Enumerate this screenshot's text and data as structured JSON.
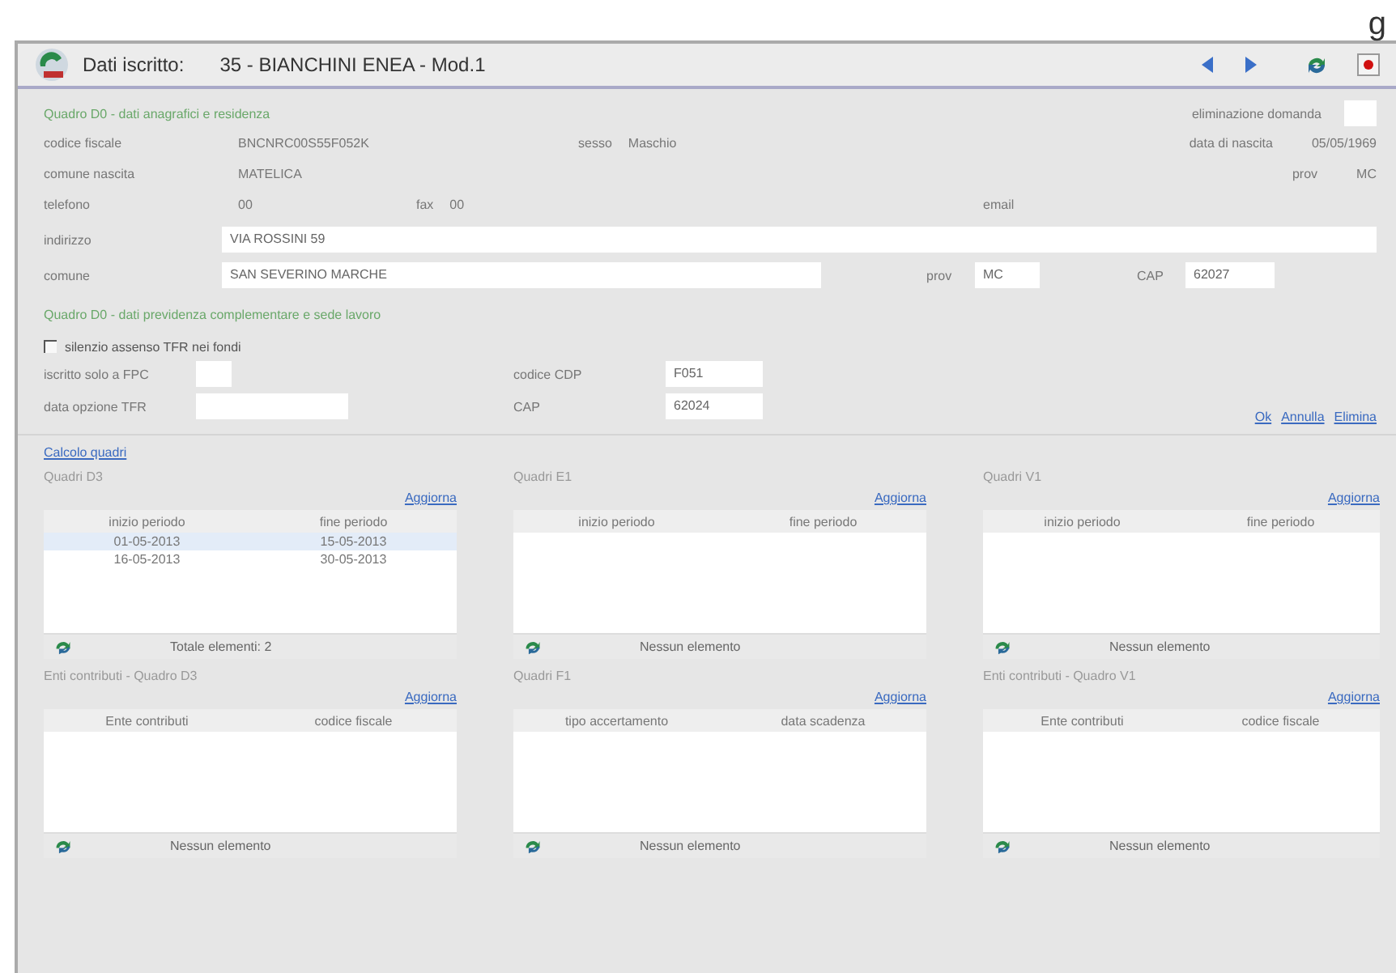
{
  "corner_text": "g",
  "window": {
    "label": "Dati iscritto:",
    "title": "35 - BIANCHINI ENEA - Mod.1"
  },
  "personal": {
    "heading": "Quadro D0 - dati anagrafici e residenza",
    "deletion": {
      "label": "eliminazione domanda",
      "checked": false
    },
    "rows": [
      [
        {
          "label": "codice fiscale",
          "value": "BNCNRC00S55F052K"
        },
        {
          "label": "sesso",
          "value": "Maschio"
        },
        {
          "label": "data di nascita",
          "value": "05/05/1969"
        }
      ],
      [
        {
          "label": "comune nascita",
          "value": "MATELICA"
        },
        {
          "label": "prov",
          "value": "MC"
        }
      ],
      [
        {
          "label": "telefono",
          "value": "00"
        },
        {
          "label": "fax",
          "value": "00"
        },
        {
          "label": "email"
        }
      ]
    ]
  },
  "address": {
    "street": {
      "label": "indirizzo",
      "value": "VIA ROSSINI 59"
    },
    "city": {
      "label": "comune",
      "value": "SAN SEVERINO MARCHE"
    },
    "prov": {
      "label": "prov",
      "value": "MC"
    },
    "cap": {
      "label": "CAP",
      "value": "62027"
    }
  },
  "pension": {
    "heading": "Quadro D0 - dati previdenza complementare e sede lavoro",
    "silent": {
      "label": "silenzio assenso TFR nei fondi",
      "checked": false
    },
    "fields": [
      {
        "label": "iscritto solo a FPC"
      },
      {
        "label": "codice CDP",
        "value": "F051"
      },
      {
        "label": "data opzione TFR"
      },
      {
        "label": "CAP",
        "value": "62024"
      }
    ]
  },
  "actions": [
    "Ok",
    "Annulla",
    "Elimina"
  ],
  "calc_link": "Calcolo quadri",
  "panels": [
    {
      "title": "Quadri D3",
      "action": "Aggiorna",
      "columns": [
        "inizio periodo",
        "fine periodo"
      ],
      "rows": [
        {
          "cells": [
            "01-05-2013",
            "15-05-2013"
          ],
          "selected": true
        },
        {
          "cells": [
            "16-05-2013",
            "30-05-2013"
          ],
          "selected": false
        }
      ],
      "footer": "Totale elementi: 2"
    },
    {
      "title": "Quadri E1",
      "action": "Aggiorna",
      "columns": [
        "inizio periodo",
        "fine periodo"
      ],
      "footer": "Nessun elemento"
    },
    {
      "title": "Quadri V1",
      "action": "Aggiorna",
      "columns": [
        "inizio periodo",
        "fine periodo"
      ],
      "footer": "Nessun elemento"
    },
    {
      "title": "Enti contributi - Quadro D3",
      "action": "Aggiorna",
      "columns": [
        "Ente contributi",
        "codice fiscale"
      ],
      "footer": "Nessun elemento"
    },
    {
      "title": "Quadri F1",
      "action": "Aggiorna",
      "columns": [
        "tipo accertamento",
        "data scadenza"
      ],
      "footer": "Nessun elemento"
    },
    {
      "title": "Enti contributi - Quadro V1",
      "action": "Aggiorna",
      "columns": [
        "Ente contributi",
        "codice fiscale"
      ],
      "footer": "Nessun elemento"
    }
  ]
}
